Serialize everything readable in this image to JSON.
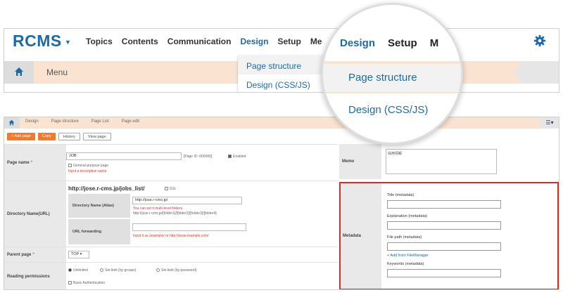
{
  "app": {
    "logo": "RCMS"
  },
  "nav": {
    "items": [
      "Topics",
      "Contents",
      "Communication",
      "Design",
      "Setup",
      "Me"
    ],
    "active": "Design"
  },
  "menu_bar": {
    "label": "Menu"
  },
  "dropdown": {
    "items": [
      "Page structure",
      "Design (CSS/JS)"
    ]
  },
  "magnifier": {
    "nav": [
      "Design",
      "Setup",
      "M"
    ],
    "items": [
      "Page structure",
      "Design (CSS/JS)"
    ]
  },
  "breadcrumb": [
    "Design",
    "Page structure",
    "Page List",
    "Page edit"
  ],
  "toolbar": {
    "add_page": "+ Add page",
    "copy": "Copy",
    "history": "History",
    "view_page": "View page"
  },
  "form": {
    "page_name": {
      "label": "Page name",
      "value": "JOB",
      "page_id": "[Page ID :000000]",
      "enabled": "Enabled",
      "general_purpose": "General-purpose page",
      "hint": "Input a descriptive name"
    },
    "directory": {
      "label": "Directory Name(URL)",
      "url": "http://jose.r-cms.jp/jobs_list/",
      "ssl": "SSL",
      "alias_label": "Directory Name (Alias)",
      "alias_value": "http://jose.r-cms.jp/",
      "alias_hint1": "You can set it multi-level folders.",
      "alias_hint2": "http://jose.r-cms.jp/[folder1]/[folder2]/[folder3]/[folder4]",
      "forwarding_label": "URL forwarding",
      "forwarding_hint": "Input it as /example/ or http://www.example.com/"
    },
    "parent_page": {
      "label": "Parent page",
      "value": "TOP"
    },
    "reading_permissions": {
      "label": "Reading permissions",
      "options": [
        "Unlimited",
        "Set limit (by groups)",
        "Set limit (by password)"
      ],
      "basic_auth": "Basic Authentication"
    },
    "memo": {
      "label": "Memo",
      "value": "採用情報"
    },
    "metadata": {
      "label": "Metadata",
      "title": "Title (metadata)",
      "explanation": "Explanation (metadata)",
      "file_path": "File path (metadata)",
      "file_manager": "+ Add from FileManager",
      "keywords": "Keywords (metadata)"
    }
  },
  "colors": {
    "brand": "#1e6aa8",
    "strip": "#fbe3d2",
    "orange": "#f07b2c",
    "highlight": "#d42d2d"
  }
}
